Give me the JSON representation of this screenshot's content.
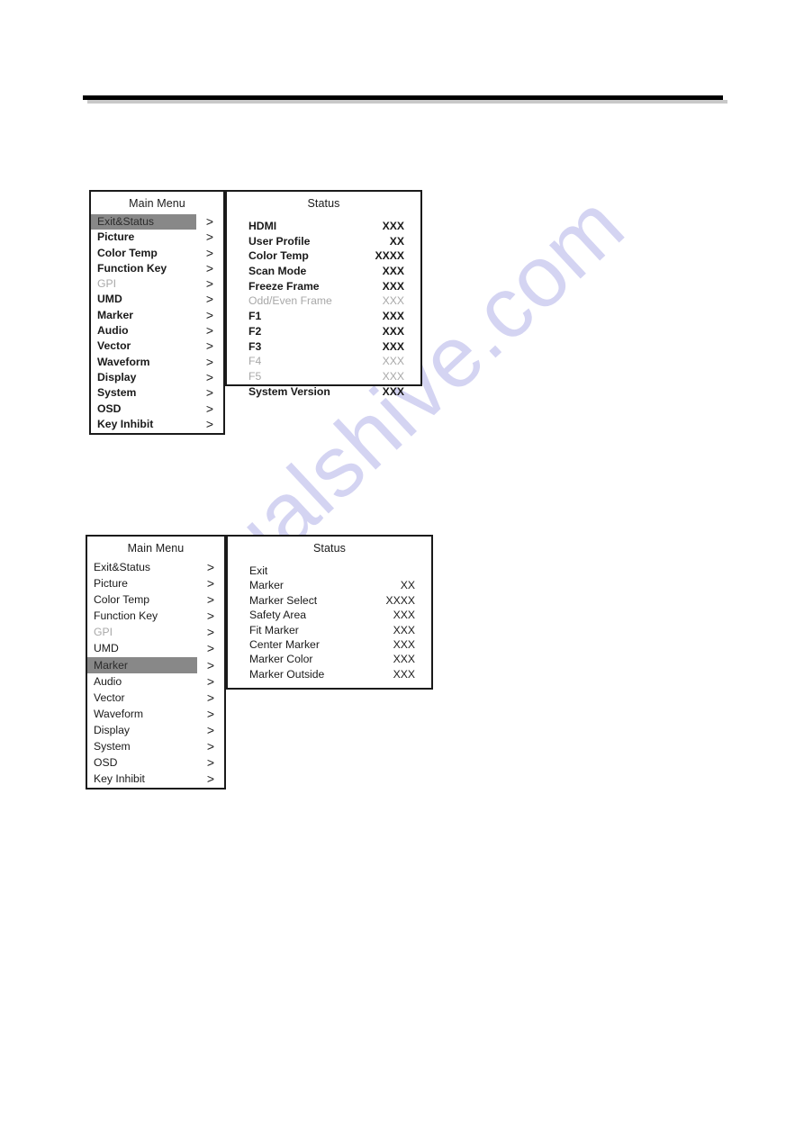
{
  "page": {
    "header_rule": "horizontal-rule",
    "watermark": "manualshive.com"
  },
  "figures": [
    {
      "id": "figure-1",
      "main_menu": {
        "title": "Main Menu",
        "items": [
          {
            "label": "Exit&Status",
            "arrow": ">",
            "state": "highlight"
          },
          {
            "label": "Picture",
            "arrow": ">",
            "state": "normal"
          },
          {
            "label": "Color Temp",
            "arrow": ">",
            "state": "normal"
          },
          {
            "label": "Function Key",
            "arrow": ">",
            "state": "normal"
          },
          {
            "label": "GPI",
            "arrow": ">",
            "state": "disabled"
          },
          {
            "label": "UMD",
            "arrow": ">",
            "state": "normal"
          },
          {
            "label": "Marker",
            "arrow": ">",
            "state": "normal"
          },
          {
            "label": "Audio",
            "arrow": ">",
            "state": "normal"
          },
          {
            "label": "Vector",
            "arrow": ">",
            "state": "normal"
          },
          {
            "label": "Waveform",
            "arrow": ">",
            "state": "normal"
          },
          {
            "label": "Display",
            "arrow": ">",
            "state": "normal"
          },
          {
            "label": "System",
            "arrow": ">",
            "state": "normal"
          },
          {
            "label": "OSD",
            "arrow": ">",
            "state": "normal"
          },
          {
            "label": "Key Inhibit",
            "arrow": ">",
            "state": "normal"
          }
        ]
      },
      "status": {
        "title": "Status",
        "rows": [
          {
            "name": "HDMI",
            "value": "XXX",
            "state": "normal"
          },
          {
            "name": "User Profile",
            "value": "XX",
            "state": "normal"
          },
          {
            "name": "Color Temp",
            "value": "XXXX",
            "state": "normal"
          },
          {
            "name": "Scan Mode",
            "value": "XXX",
            "state": "normal"
          },
          {
            "name": "Freeze Frame",
            "value": "XXX",
            "state": "normal"
          },
          {
            "name": "Odd/Even Frame",
            "value": "XXX",
            "state": "disabled"
          },
          {
            "name": "F1",
            "value": "XXX",
            "state": "normal"
          },
          {
            "name": "F2",
            "value": "XXX",
            "state": "normal"
          },
          {
            "name": "F3",
            "value": "XXX",
            "state": "normal"
          },
          {
            "name": "F4",
            "value": "XXX",
            "state": "disabled"
          },
          {
            "name": "F5",
            "value": "XXX",
            "state": "disabled"
          },
          {
            "name": "System Version",
            "value": "XXX",
            "state": "normal"
          }
        ]
      }
    },
    {
      "id": "figure-2",
      "main_menu": {
        "title": "Main Menu",
        "items": [
          {
            "label": "Exit&Status",
            "arrow": ">",
            "state": "normal"
          },
          {
            "label": "Picture",
            "arrow": ">",
            "state": "normal"
          },
          {
            "label": "Color Temp",
            "arrow": ">",
            "state": "normal"
          },
          {
            "label": "Function Key",
            "arrow": ">",
            "state": "normal"
          },
          {
            "label": "GPI",
            "arrow": ">",
            "state": "disabled"
          },
          {
            "label": "UMD",
            "arrow": ">",
            "state": "normal"
          },
          {
            "label": "Marker",
            "arrow": ">",
            "state": "highlight"
          },
          {
            "label": "Audio",
            "arrow": ">",
            "state": "normal"
          },
          {
            "label": "Vector",
            "arrow": ">",
            "state": "normal"
          },
          {
            "label": "Waveform",
            "arrow": ">",
            "state": "normal"
          },
          {
            "label": "Display",
            "arrow": ">",
            "state": "normal"
          },
          {
            "label": "System",
            "arrow": ">",
            "state": "normal"
          },
          {
            "label": "OSD",
            "arrow": ">",
            "state": "normal"
          },
          {
            "label": "Key Inhibit",
            "arrow": ">",
            "state": "normal"
          }
        ]
      },
      "status": {
        "title": "Status",
        "rows": [
          {
            "name": "Exit",
            "value": "",
            "state": "normal"
          },
          {
            "name": "Marker",
            "value": "XX",
            "state": "normal"
          },
          {
            "name": "Marker Select",
            "value": "XXXX",
            "state": "normal"
          },
          {
            "name": "Safety Area",
            "value": "XXX",
            "state": "normal"
          },
          {
            "name": "Fit Marker",
            "value": "XXX",
            "state": "normal"
          },
          {
            "name": "Center Marker",
            "value": "XXX",
            "state": "normal"
          },
          {
            "name": "Marker Color",
            "value": "XXX",
            "state": "normal"
          },
          {
            "name": "Marker Outside",
            "value": "XXX",
            "state": "normal"
          }
        ]
      }
    }
  ],
  "colors": {
    "highlight_bg": "#888888",
    "disabled_text": "#a8a8a8",
    "text": "#1a1a1a",
    "rule": "#000000",
    "rule_shadow": "#c8c8c8",
    "watermark": "#d4d4f2"
  }
}
